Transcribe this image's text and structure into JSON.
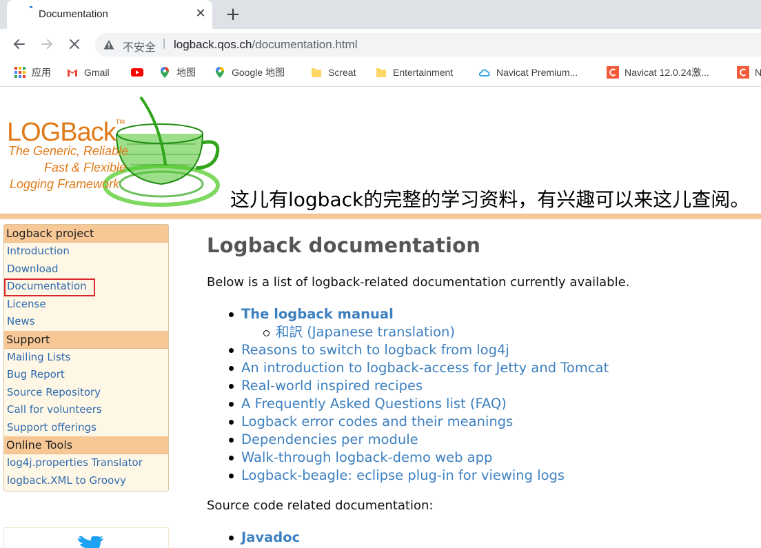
{
  "browser": {
    "tab_title": "Documentation",
    "close_glyph": "✕",
    "newtab_glyph": "+",
    "insecure_label": "不安全",
    "separator": "|",
    "url_host": "logback.qos.ch",
    "url_path": "/documentation.html",
    "bookmarks": [
      {
        "label": "应用",
        "icon": "apps-grid-icon"
      },
      {
        "label": "Gmail",
        "icon": "gmail-icon"
      },
      {
        "label": "",
        "icon": "youtube-icon"
      },
      {
        "label": "地图",
        "icon": "maps-pin-icon"
      },
      {
        "label": "Google 地图",
        "icon": "maps-pin-icon"
      },
      {
        "label": "Screat",
        "icon": "folder-icon"
      },
      {
        "label": "Entertainment",
        "icon": "folder-icon"
      },
      {
        "label": "Navicat Premium...",
        "icon": "navicat-cloud-icon"
      },
      {
        "label": "Navicat 12.0.24激...",
        "icon": "c-logo-icon"
      },
      {
        "label": "N",
        "icon": "c-logo-icon"
      }
    ]
  },
  "logo": {
    "word": "LOGBack",
    "tm": "TM",
    "tag1": "The Generic, Reliable",
    "tag2": "Fast & Flexible",
    "tag3": "Logging Framework"
  },
  "annotation": "这儿有logback的完整的学习资料，有兴趣可以来这儿查阅。",
  "sidebar": {
    "sections": [
      {
        "title": "Logback project",
        "items": [
          "Introduction",
          "Download",
          "Documentation",
          "License",
          "News"
        ]
      },
      {
        "title": "Support",
        "items": [
          "Mailing Lists",
          "Bug Report",
          "Source Repository",
          "Call for volunteers",
          "Support offerings"
        ]
      },
      {
        "title": "Online Tools",
        "items": [
          "log4j.properties Translator",
          "logback.XML to Groovy"
        ]
      }
    ],
    "selected": "Documentation"
  },
  "main": {
    "heading": "Logback documentation",
    "intro": "Below is a list of logback-related documentation currently available.",
    "docs": [
      {
        "label": "The logback manual",
        "bold": true
      },
      {
        "label": "和訳 (Japanese translation)",
        "sub": true
      },
      {
        "label": "Reasons to switch to logback from log4j"
      },
      {
        "label": "An introduction to logback-access for Jetty and Tomcat"
      },
      {
        "label": "Real-world inspired recipes"
      },
      {
        "label": "A Frequently Asked Questions list (FAQ)"
      },
      {
        "label": "Logback error codes and their meanings"
      },
      {
        "label": "Dependencies per module"
      },
      {
        "label": "Walk-through logback-demo web app"
      },
      {
        "label": "Logback-beagle: eclipse plug-in for viewing logs"
      }
    ],
    "source_heading": "Source code related documentation:",
    "source_docs": [
      {
        "label": "Javadoc",
        "bold": true
      }
    ]
  }
}
